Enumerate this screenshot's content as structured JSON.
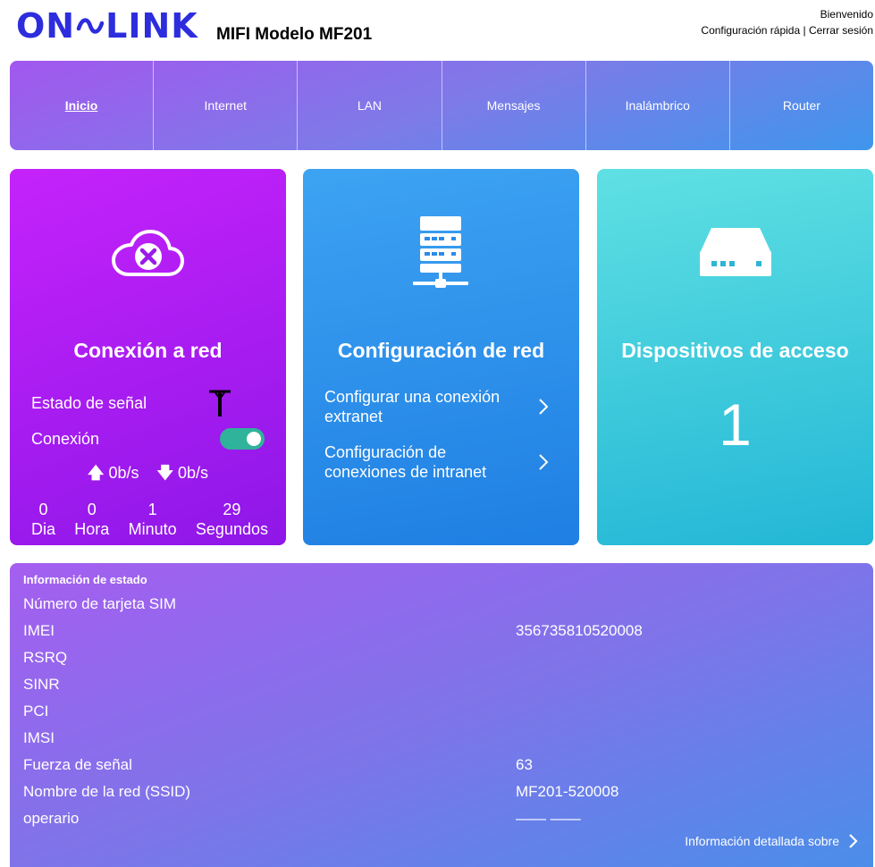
{
  "header": {
    "logo_text_left": "ON",
    "logo_text_right": "LINK",
    "model": "MIFI Modelo MF201",
    "welcome": "Bienvenido",
    "quick_config": "Configuración rápida",
    "separator": "|",
    "logout": "Cerrar sesión"
  },
  "nav": {
    "items": [
      {
        "label": "Inicio"
      },
      {
        "label": "Internet"
      },
      {
        "label": "LAN"
      },
      {
        "label": "Mensajes"
      },
      {
        "label": "Inalámbrico"
      },
      {
        "label": "Router"
      }
    ]
  },
  "network_card": {
    "title": "Conexión a red",
    "signal_label": "Estado de señal",
    "connection_label": "Conexión",
    "upload": "0b/s",
    "download": "0b/s",
    "timer": {
      "days": "0",
      "days_label": "Dia",
      "hours": "0",
      "hours_label": "Hora",
      "minutes": "1",
      "minutes_label": "Minuto",
      "seconds": "29",
      "seconds_label": "Segundos"
    }
  },
  "config_card": {
    "title": "Configuración de red",
    "link1": "Configurar una conexión extranet",
    "link2": "Configuración de conexiones de intranet"
  },
  "devices_card": {
    "title": "Dispositivos de acceso",
    "count": "1"
  },
  "status": {
    "heading": "Información de estado",
    "rows": [
      {
        "label": "Número de tarjeta SIM",
        "value": ""
      },
      {
        "label": "IMEI",
        "value": "356735810520008"
      },
      {
        "label": "RSRQ",
        "value": ""
      },
      {
        "label": "SINR",
        "value": ""
      },
      {
        "label": "PCI",
        "value": ""
      },
      {
        "label": "IMSI",
        "value": ""
      },
      {
        "label": "Fuerza de señal",
        "value": "63"
      },
      {
        "label": "Nombre de la red (SSID)",
        "value": "MF201-520008"
      },
      {
        "label": "operario",
        "value": "—— ——"
      }
    ],
    "detail_link": "Información detallada sobre"
  },
  "colors": {
    "logo": "#2d2dde",
    "toggle_on": "#2fb39a"
  }
}
